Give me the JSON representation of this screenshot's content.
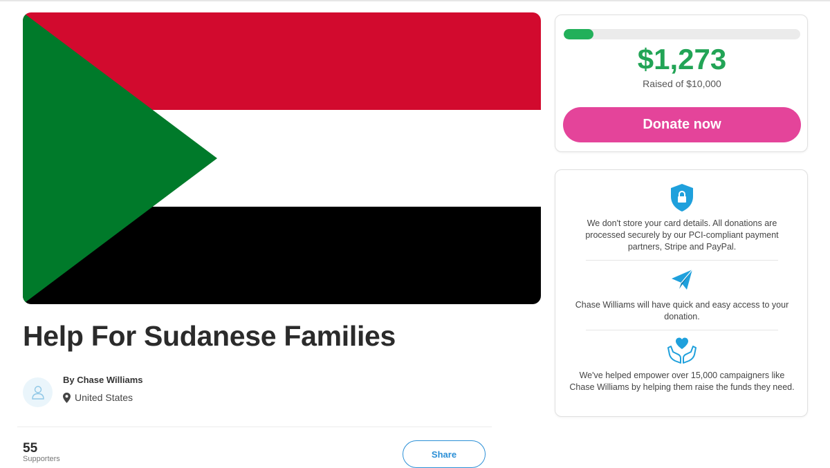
{
  "campaign": {
    "title": "Help For Sudanese Families",
    "organizer": "By Chase Williams",
    "location": "United States",
    "hero_image": "sudan-flag",
    "flag_colors": {
      "red": "#d20a2e",
      "white": "#ffffff",
      "black": "#000000",
      "green": "#007a2a"
    }
  },
  "stats": {
    "supporters_count": "55",
    "supporters_label": "Supporters"
  },
  "actions": {
    "share_label": "Share",
    "donate_label": "Donate now"
  },
  "fundraising": {
    "raised": "$1,273",
    "raised_of": "Raised of $10,000",
    "progress_percent": 12.7,
    "progress_color": "#22b05a",
    "amount_color": "#22a456",
    "donate_color": "#e4449a"
  },
  "trust_info": [
    {
      "icon": "shield-lock-icon",
      "text": "We don't store your card details. All donations are processed securely by our PCI-compliant payment partners, Stripe and PayPal."
    },
    {
      "icon": "paper-plane-icon",
      "text": "Chase Williams will have quick and easy access to your donation."
    },
    {
      "icon": "heart-hands-icon",
      "text": "We've helped empower over 15,000 campaigners like Chase Williams by helping them raise the funds they need."
    }
  ],
  "accent_color": "#2b8fd6"
}
